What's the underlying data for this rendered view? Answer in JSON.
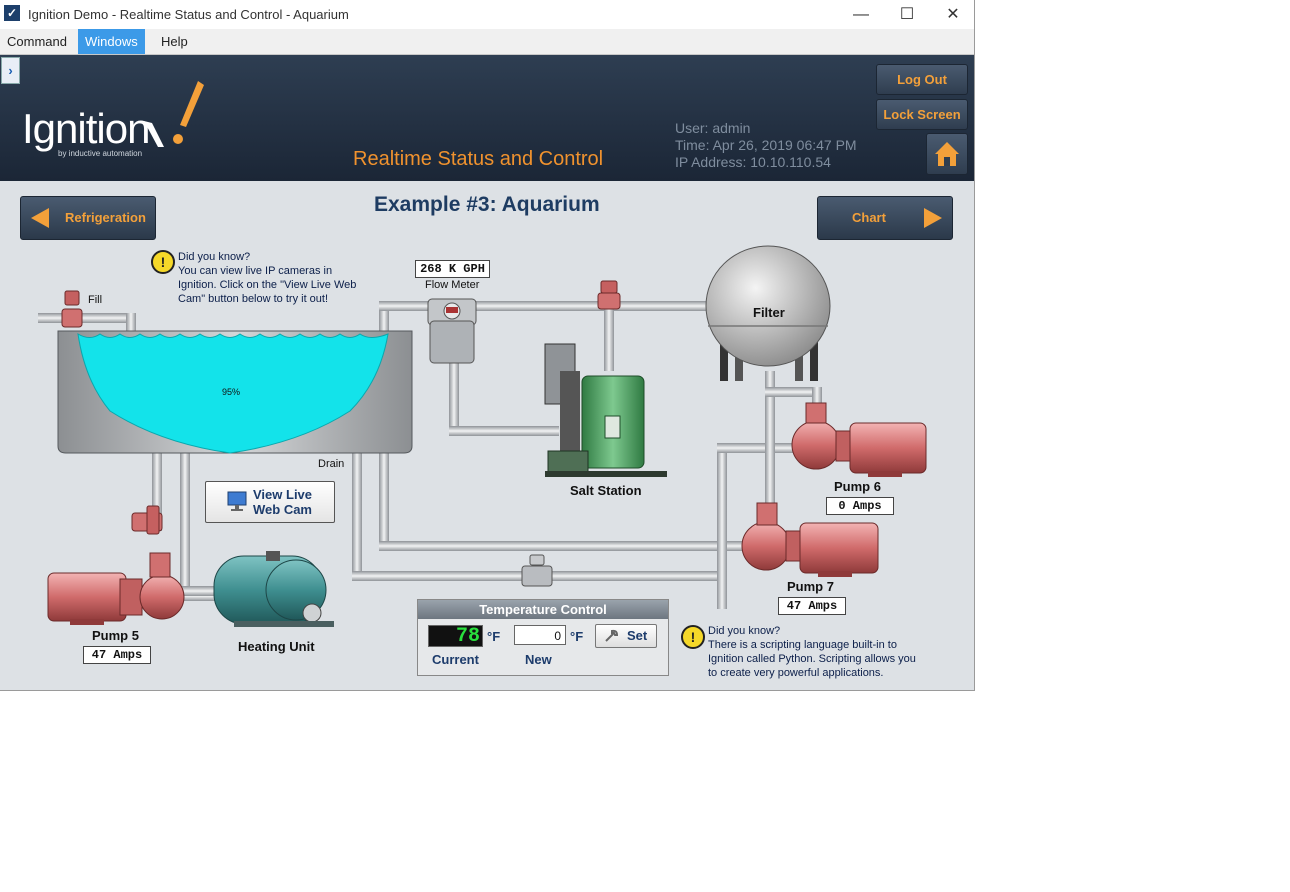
{
  "window": {
    "title": "Ignition Demo - Realtime Status and Control - Aquarium",
    "minimize_glyph": "—",
    "maximize_glyph": "☐",
    "close_glyph": "✕"
  },
  "menubar": {
    "items": [
      "Command",
      "Windows",
      "Help"
    ],
    "active": "Windows"
  },
  "header": {
    "logo": "Ignition",
    "logo_sub": "by inductive automation",
    "title": "Realtime Status and Control",
    "user": "User: admin",
    "time": "Time: Apr 26, 2019 06:47 PM",
    "ip": "IP Address: 10.10.110.54",
    "logout_label": "Log Out",
    "lock_label": "Lock Screen",
    "home_icon": "home-icon",
    "accent_color": "#f3a03a"
  },
  "main": {
    "page_title": "Example #3: Aquarium",
    "nav_prev_label": "Refrigeration",
    "nav_next_label": "Chart",
    "tip1": {
      "heading": "Did you know?",
      "body": "You can view live IP cameras in Ignition. Click on the \"View Live Web Cam\" button below to try it out!",
      "line1": "You can view live IP cameras in",
      "line2": "Ignition. Click on the \"View Live Web",
      "line3": "Cam\" button below to try it out!"
    },
    "tip2": {
      "heading": "Did you know?",
      "line1": "There is a scripting language built-in to",
      "line2": "Ignition called Python. Scripting allows you",
      "line3": "to create very powerful applications."
    },
    "tank": {
      "level_text": "95%",
      "level": 0.95,
      "fill_label": "Fill",
      "drain_label": "Drain"
    },
    "flow_meter": {
      "value": "268 K GPH",
      "label": "Flow Meter"
    },
    "filter_label": "Filter",
    "salt_station_label": "Salt Station",
    "heating_unit_label": "Heating Unit",
    "webcam_button": {
      "line1": "View Live",
      "line2": "Web Cam"
    },
    "pumps": [
      {
        "name": "Pump 5",
        "amps": "47 Amps"
      },
      {
        "name": "Pump 6",
        "amps": "0 Amps"
      },
      {
        "name": "Pump 7",
        "amps": "47 Amps"
      }
    ],
    "temperature": {
      "title": "Temperature Control",
      "current": "78",
      "new": "0",
      "unit": "°F",
      "current_label": "Current",
      "new_label": "New",
      "set_label": "Set"
    }
  }
}
